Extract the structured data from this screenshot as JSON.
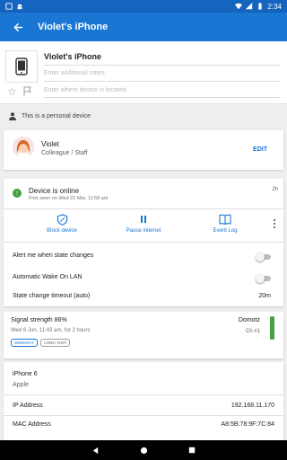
{
  "status_bar": {
    "time": "2:34"
  },
  "app_bar": {
    "title": "Violet's iPhone"
  },
  "device": {
    "name": "Violet's iPhone",
    "notes_placeholder": "Enter additional notes",
    "location_placeholder": "Enter where device is located",
    "personal_label": "This is a personal device"
  },
  "user": {
    "name": "Violet",
    "role": "Colleague / Staff",
    "edit_label": "EDIT"
  },
  "status": {
    "online_title": "Device is online",
    "first_seen": "First seen on Wed 22 Mar, 11:58 am",
    "ago": "2h",
    "actions": [
      {
        "label": "Block device",
        "icon": "block-icon"
      },
      {
        "label": "Pause internet",
        "icon": "pause-icon"
      },
      {
        "label": "Event Log",
        "icon": "book-icon"
      }
    ],
    "alert_label": "Alert me when state changes",
    "alert_on": false,
    "wol_label": "Automatic Wake On LAN",
    "wol_on": false,
    "timeout_label": "State change timeout (auto)",
    "timeout_value": "20m"
  },
  "signal": {
    "title": "Signal strength 86%",
    "time": "Wed 6 Jun, 11:43 am, for 2 hours",
    "tags": [
      "WEEKDAY",
      "LONG VISIT"
    ],
    "network": "Domotz",
    "channel": "Ch #1",
    "strength": 86
  },
  "details": {
    "model": "iPhone 6",
    "maker": "Apple",
    "ip_label": "IP Address",
    "ip_value": "192.168.11.170",
    "mac_label": "MAC Address",
    "mac_value": "A8:5B:78:9F:7C:84"
  },
  "colors": {
    "primary": "#1976d2",
    "statusbar": "#1565c0",
    "online": "#43a047"
  }
}
